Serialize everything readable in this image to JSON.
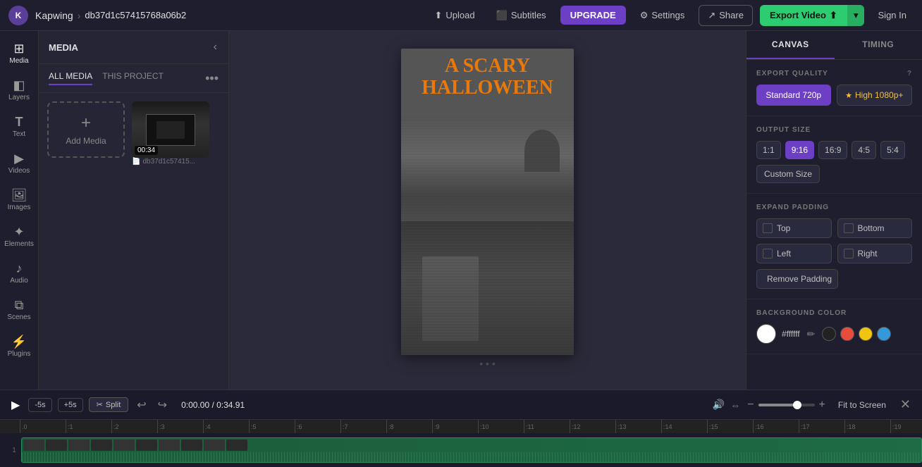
{
  "app": {
    "logo_text": "K",
    "brand": "Kapwing",
    "separator": "›",
    "project_id": "db37d1c57415768a06b2"
  },
  "topbar": {
    "upload_label": "Upload",
    "subtitles_label": "Subtitles",
    "upgrade_label": "UPGRADE",
    "settings_label": "Settings",
    "share_label": "Share",
    "export_label": "Export Video",
    "signin_label": "Sign In"
  },
  "sidebar": {
    "items": [
      {
        "id": "media",
        "label": "Media",
        "icon": "⊞"
      },
      {
        "id": "layers",
        "label": "Layers",
        "icon": "◧"
      },
      {
        "id": "text",
        "label": "Text",
        "icon": "T"
      },
      {
        "id": "videos",
        "label": "Videos",
        "icon": "▶"
      },
      {
        "id": "images",
        "label": "Images",
        "icon": "⬜"
      },
      {
        "id": "elements",
        "label": "Elements",
        "icon": "✦"
      },
      {
        "id": "audio",
        "label": "Audio",
        "icon": "♪"
      },
      {
        "id": "scenes",
        "label": "Scenes",
        "icon": "⧉"
      },
      {
        "id": "plugins",
        "label": "Plugins",
        "icon": "⚡"
      }
    ]
  },
  "media_panel": {
    "title": "MEDIA",
    "tabs": [
      {
        "id": "all",
        "label": "ALL MEDIA"
      },
      {
        "id": "project",
        "label": "THIS PROJECT"
      }
    ],
    "add_media_label": "Add Media",
    "thumbnail": {
      "duration": "00:34",
      "filename": "db37d1c57415..."
    }
  },
  "canvas": {
    "preview_title_line1": "A SCARY",
    "preview_title_line2": "HALLOWEEN"
  },
  "right_panel": {
    "tabs": [
      {
        "id": "canvas",
        "label": "CANVAS"
      },
      {
        "id": "timing",
        "label": "TIMING"
      }
    ],
    "export_quality": {
      "label": "EXPORT QUALITY",
      "options": [
        {
          "id": "720p",
          "label": "Standard 720p",
          "active": true
        },
        {
          "id": "1080p",
          "label": "High 1080p+",
          "active": false,
          "premium": true
        }
      ]
    },
    "output_size": {
      "label": "OUTPUT SIZE",
      "options": [
        {
          "id": "1:1",
          "label": "1:1"
        },
        {
          "id": "9:16",
          "label": "9:16",
          "active": true
        },
        {
          "id": "16:9",
          "label": "16:9"
        },
        {
          "id": "4:5",
          "label": "4:5"
        },
        {
          "id": "5:4",
          "label": "5:4"
        }
      ],
      "custom_label": "Custom Size"
    },
    "expand_padding": {
      "label": "EXPAND PADDING",
      "options": [
        {
          "id": "top",
          "label": "Top"
        },
        {
          "id": "bottom",
          "label": "Bottom"
        },
        {
          "id": "left",
          "label": "Left"
        },
        {
          "id": "right",
          "label": "Right"
        }
      ],
      "remove_label": "Remove Padding"
    },
    "background_color": {
      "label": "BACKGROUND COLOR",
      "hex": "#ffffff",
      "presets": [
        {
          "id": "black",
          "color": "#222222"
        },
        {
          "id": "red",
          "color": "#e74c3c"
        },
        {
          "id": "yellow",
          "color": "#f1c40f"
        },
        {
          "id": "blue",
          "color": "#3498db"
        }
      ]
    }
  },
  "bottom_bar": {
    "play_icon": "▶",
    "skip_back_label": "-5s",
    "skip_fwd_label": "+5s",
    "split_label": "Split",
    "time_current": "0:00.00",
    "time_total": "0:34.91",
    "time_display": "0:00.00 / 0:34.91",
    "fit_screen_label": "Fit to Screen"
  },
  "timeline": {
    "track_number": "1",
    "ruler_marks": [
      ".0",
      ":1",
      ":2",
      ":3",
      ":4",
      ":5",
      ":6",
      ":7",
      ":8",
      ":9",
      ":10",
      ":11",
      ":12",
      ":13",
      ":14",
      ":15",
      ":16",
      ":17",
      ":18",
      ":19"
    ]
  }
}
